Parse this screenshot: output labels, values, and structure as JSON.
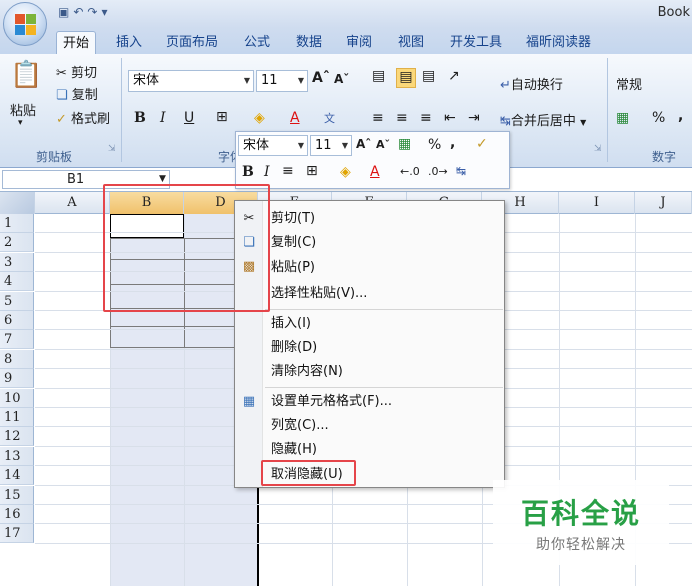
{
  "window": {
    "title": "Book"
  },
  "tabs": [
    "开始",
    "插入",
    "页面布局",
    "公式",
    "数据",
    "审阅",
    "视图",
    "开发工具",
    "福昕阅读器"
  ],
  "ribbon": {
    "clipboard": {
      "paste": "粘贴",
      "cut": "剪切",
      "copy": "复制",
      "format_painter": "格式刷",
      "label": "剪贴板"
    },
    "font": {
      "name": "宋体",
      "size": "11",
      "bold": "B",
      "italic": "I",
      "underline": "U",
      "label": "字体"
    },
    "alignment": {
      "wrap": "自动换行",
      "merge": "合并后居中"
    },
    "number": {
      "format": "常规",
      "percent": "%",
      "comma": ",",
      "label": "数字"
    }
  },
  "formula_bar": {
    "name_box": "B1"
  },
  "columns": [
    "A",
    "B",
    "D",
    "E",
    "F",
    "G",
    "H",
    "I",
    "J"
  ],
  "rows": [
    "1",
    "2",
    "3",
    "4",
    "5",
    "6",
    "7",
    "8",
    "9",
    "10",
    "11",
    "12",
    "13",
    "14",
    "15",
    "16",
    "17"
  ],
  "mini_toolbar": {
    "font": "宋体",
    "size": "11",
    "bold": "B",
    "italic": "I",
    "percent": "%",
    "comma": ","
  },
  "context_menu": {
    "items": [
      {
        "label": "剪切(T)",
        "icon": "scissors-icon"
      },
      {
        "label": "复制(C)",
        "icon": "copy-icon"
      },
      {
        "label": "粘贴(P)",
        "icon": "paste-icon"
      },
      {
        "label": "选择性粘贴(V)...",
        "icon": ""
      },
      {
        "label": "插入(I)",
        "icon": ""
      },
      {
        "label": "删除(D)",
        "icon": ""
      },
      {
        "label": "清除内容(N)",
        "icon": ""
      },
      {
        "label": "设置单元格格式(F)...",
        "icon": "format-cells-icon"
      },
      {
        "label": "列宽(C)...",
        "icon": ""
      },
      {
        "label": "隐藏(H)",
        "icon": ""
      },
      {
        "label": "取消隐藏(U)",
        "icon": ""
      }
    ]
  },
  "watermark": {
    "title": "百科全说",
    "subtitle": "助你轻松解决"
  },
  "colors": {
    "highlight": "#e5454a",
    "selected_header": "#f0c16b",
    "ribbon": "#dfe9f5"
  }
}
